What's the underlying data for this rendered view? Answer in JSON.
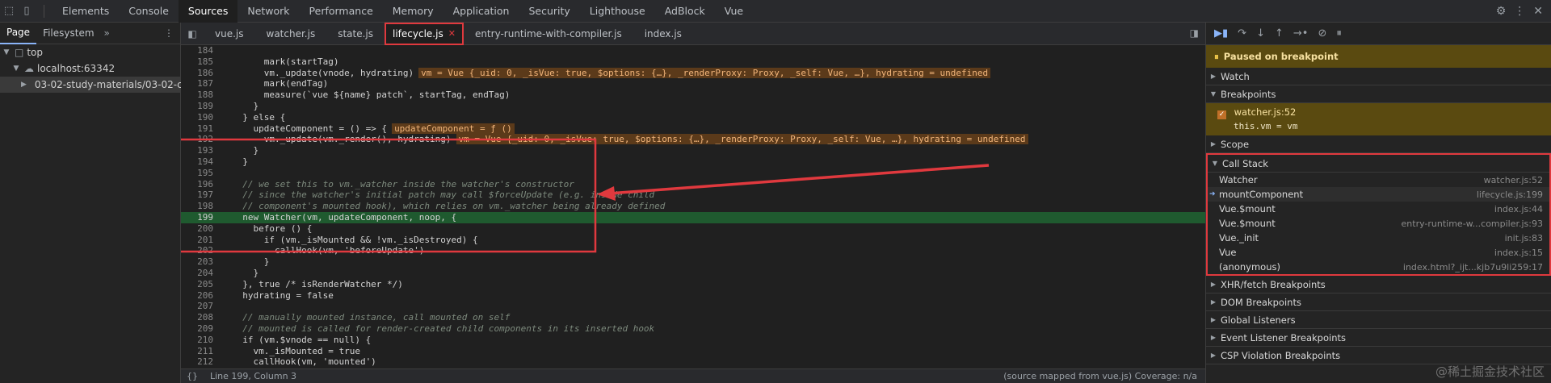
{
  "toolbar": {
    "tabs": [
      "Elements",
      "Console",
      "Sources",
      "Network",
      "Performance",
      "Memory",
      "Application",
      "Security",
      "Lighthouse",
      "AdBlock",
      "Vue"
    ],
    "active_tab": "Sources"
  },
  "navigator": {
    "tabs": [
      "Page",
      "Filesystem"
    ],
    "more": "»",
    "tree": [
      "top",
      "localhost:63342",
      "03-02-study-materials/03-02-c"
    ]
  },
  "editor": {
    "file_tabs": [
      "vue.js",
      "watcher.js",
      "state.js",
      "lifecycle.js",
      "entry-runtime-with-compiler.js",
      "index.js"
    ],
    "active_file": "lifecycle.js",
    "lines": [
      {
        "n": "184",
        "code": ""
      },
      {
        "n": "185",
        "code": "      mark(startTag)"
      },
      {
        "n": "186",
        "code": "      vm._update(vnode, hydrating)",
        "inline": "vm = Vue {_uid: 0, _isVue: true, $options: {…}, _renderProxy: Proxy, _self: Vue, …}, hydrating = undefined"
      },
      {
        "n": "187",
        "code": "      mark(endTag)"
      },
      {
        "n": "188",
        "code": "      measure(`vue ${name} patch`, startTag, endTag)"
      },
      {
        "n": "189",
        "code": "    }"
      },
      {
        "n": "190",
        "code": "  } else {"
      },
      {
        "n": "191",
        "code": "    updateComponent = () => {",
        "inline": "updateComponent = ƒ ()"
      },
      {
        "n": "192",
        "code": "      vm._update(vm._render(), hydrating)",
        "inline": "vm = Vue {_uid: 0, _isVue: true, $options: {…}, _renderProxy: Proxy, _self: Vue, …}, hydrating = undefined"
      },
      {
        "n": "193",
        "code": "    }"
      },
      {
        "n": "194",
        "code": "  }"
      },
      {
        "n": "195",
        "code": ""
      },
      {
        "n": "196",
        "code": "  // we set this to vm._watcher inside the watcher's constructor",
        "comment": true
      },
      {
        "n": "197",
        "code": "  // since the watcher's initial patch may call $forceUpdate (e.g. inside child",
        "comment": true
      },
      {
        "n": "198",
        "code": "  // component's mounted hook), which relies on vm._watcher being already defined",
        "comment": true
      },
      {
        "n": "199",
        "code": "  new Watcher(vm, updateComponent, noop, {",
        "highlight": true
      },
      {
        "n": "200",
        "code": "    before () {"
      },
      {
        "n": "201",
        "code": "      if (vm._isMounted && !vm._isDestroyed) {"
      },
      {
        "n": "202",
        "code": "        callHook(vm, 'beforeUpdate')"
      },
      {
        "n": "203",
        "code": "      }"
      },
      {
        "n": "204",
        "code": "    }"
      },
      {
        "n": "205",
        "code": "  }, true /* isRenderWatcher */)"
      },
      {
        "n": "206",
        "code": "  hydrating = false"
      },
      {
        "n": "207",
        "code": ""
      },
      {
        "n": "208",
        "code": "  // manually mounted instance, call mounted on self",
        "comment": true
      },
      {
        "n": "209",
        "code": "  // mounted is called for render-created child components in its inserted hook",
        "comment": true
      },
      {
        "n": "210",
        "code": "  if (vm.$vnode == null) {"
      },
      {
        "n": "211",
        "code": "    vm._isMounted = true"
      },
      {
        "n": "212",
        "code": "    callHook(vm, 'mounted')"
      }
    ],
    "status": {
      "brace": "{}",
      "position": "Line 199, Column 3",
      "source_map": "(source mapped from vue.js) Coverage: n/a"
    }
  },
  "debugger": {
    "paused_label": "Paused on breakpoint",
    "sections": {
      "watch": "Watch",
      "breakpoints": "Breakpoints",
      "scope": "Scope",
      "call_stack": "Call Stack",
      "xhr": "XHR/fetch Breakpoints",
      "dom": "DOM Breakpoints",
      "global": "Global Listeners",
      "event": "Event Listener Breakpoints",
      "csp": "CSP Violation Breakpoints"
    },
    "breakpoint": {
      "location": "watcher.js:52",
      "code": "this.vm = vm"
    },
    "call_stack": [
      {
        "name": "Watcher",
        "location": "watcher.js:52"
      },
      {
        "name": "mountComponent",
        "location": "lifecycle.js:199",
        "current": true
      },
      {
        "name": "Vue.$mount",
        "location": "index.js:44"
      },
      {
        "name": "Vue.$mount",
        "location": "entry-runtime-w...compiler.js:93"
      },
      {
        "name": "Vue._init",
        "location": "init.js:83"
      },
      {
        "name": "Vue",
        "location": "index.js:15"
      },
      {
        "name": "(anonymous)",
        "location": "index.html?_ijt...kjb7u9li259:17"
      }
    ]
  },
  "watermark": "@稀土掘金技术社区",
  "colors": {
    "annotation": "#e0393e",
    "highlight_line": "#1f5a2f",
    "paused_bg": "#5a4a10"
  }
}
